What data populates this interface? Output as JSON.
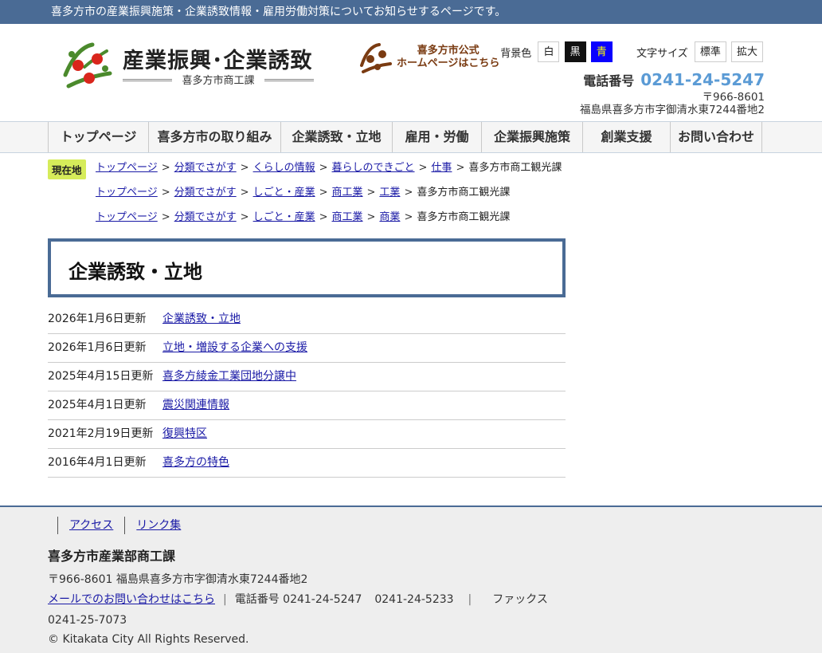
{
  "topbar": {
    "text": "喜多方市の産業振興施策・企業誘致情報・雇用労働対策についてお知らせするページです。"
  },
  "header": {
    "logo_title": "産業振興･企業誘致",
    "logo_subtitle": "喜多方市商工課",
    "city_link_line1": "喜多方市公式",
    "city_link_line2": "ホームページはこちら",
    "bg_label": "背景色",
    "bg_options": [
      "白",
      "黒",
      "青"
    ],
    "font_label": "文字サイズ",
    "font_options": [
      "標準",
      "拡大"
    ],
    "phone_label": "電話番号",
    "phone_number": "0241-24-5247",
    "postal": "〒966-8601",
    "address": "福島県喜多方市字御清水東7244番地2"
  },
  "nav": {
    "items": [
      "トップページ",
      "喜多方市の取り組み",
      "企業誘致・立地",
      "雇用・労働",
      "企業振興施策",
      "創業支援",
      "お問い合わせ"
    ]
  },
  "breadcrumb": {
    "here_label": "現在地",
    "rows": [
      {
        "links": [
          "トップページ",
          "分類でさがす",
          "くらしの情報",
          "暮らしのできごと",
          "仕事"
        ],
        "current": "喜多方市商工観光課"
      },
      {
        "links": [
          "トップページ",
          "分類でさがす",
          "しごと・産業",
          "商工業",
          "工業"
        ],
        "current": "喜多方市商工観光課"
      },
      {
        "links": [
          "トップページ",
          "分類でさがす",
          "しごと・産業",
          "商工業",
          "商業"
        ],
        "current": "喜多方市商工観光課"
      }
    ]
  },
  "page": {
    "title": "企業誘致・立地"
  },
  "updates": [
    {
      "date": "2026年1月6日更新",
      "title": "企業誘致・立地"
    },
    {
      "date": "2026年1月6日更新",
      "title": "立地・増設する企業への支援"
    },
    {
      "date": "2025年4月15日更新",
      "title": "喜多方綾金工業団地分譲中"
    },
    {
      "date": "2025年4月1日更新",
      "title": "震災関連情報"
    },
    {
      "date": "2021年2月19日更新",
      "title": "復興特区"
    },
    {
      "date": "2016年4月1日更新",
      "title": "喜多方の特色"
    }
  ],
  "footer": {
    "links": [
      "アクセス",
      "リンク集"
    ],
    "org": "喜多方市産業部商工課",
    "address": "〒966-8601 福島県喜多方市字御清水東7244番地2",
    "mail_link": "メールでのお問い合わせはこちら",
    "phone_label": "電話番号",
    "phone1": "0241-24-5247",
    "phone2": "0241-24-5233",
    "fax_label": "ファックス",
    "fax": "0241-25-7073",
    "copyright": "© Kitakata City All Rights Reserved."
  },
  "colors": {
    "brand_blue": "#4a6b95",
    "phone_blue": "#5b9bd5",
    "badge_green": "#d6ec5a"
  }
}
